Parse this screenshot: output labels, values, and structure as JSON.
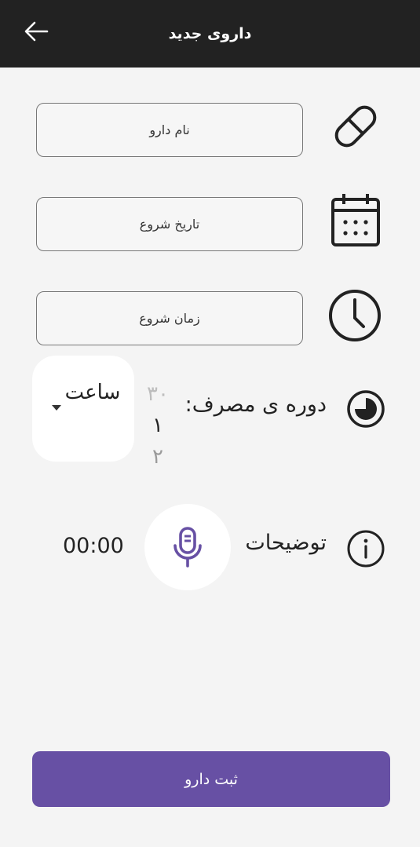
{
  "appbar": {
    "title": "داروی جدید",
    "back_icon": "arrow-left-icon"
  },
  "form": {
    "drug_name_placeholder": "نام دارو",
    "start_date_placeholder": "تاریخ شروع",
    "start_time_placeholder": "زمان شروع"
  },
  "period": {
    "label": "دوره ی مصرف:",
    "picker_values": [
      "۳۰",
      "۱",
      "۲"
    ],
    "unit": "ساعت"
  },
  "notes": {
    "label": "توضیحات",
    "timer": "00:00",
    "mic_icon": "microphone-icon"
  },
  "submit": {
    "label": "ثبت دارو"
  },
  "colors": {
    "appbar": "#222222",
    "primary": "#6750a4",
    "background": "#f4f4f4"
  }
}
